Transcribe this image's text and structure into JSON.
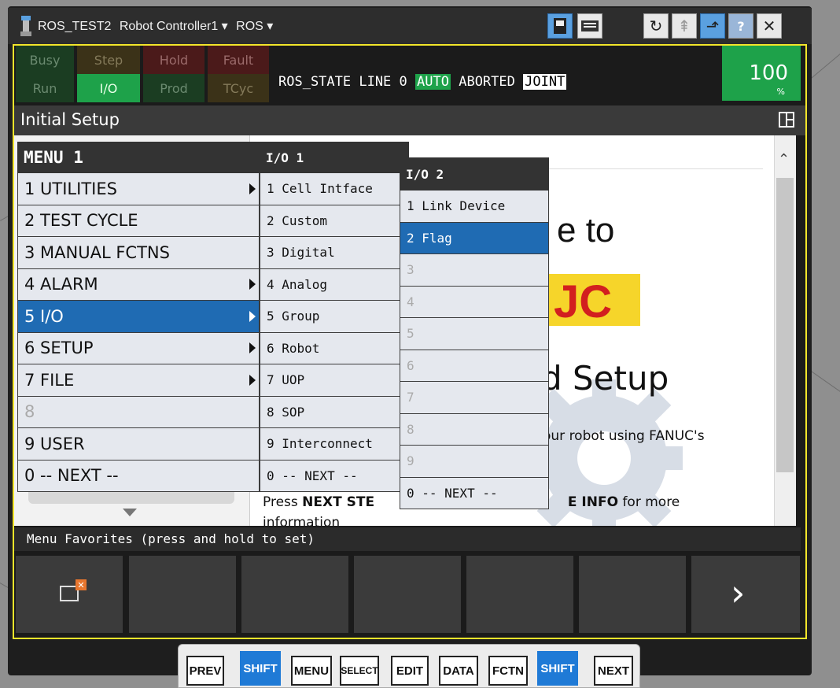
{
  "topbar": {
    "program": "ROS_TEST2",
    "controller": "Robot Controller1 ▾",
    "ros_tab": "ROS ▾"
  },
  "status": {
    "busy": "Busy",
    "step": "Step",
    "hold": "Hold",
    "fault": "Fault",
    "run": "Run",
    "io": "I/O",
    "prod": "Prod",
    "tcyc": "TCyc",
    "line_prefix": "ROS_STATE LINE 0",
    "auto": "AUTO",
    "aborted": "ABORTED",
    "joint": "JOINT"
  },
  "override": {
    "value": "100",
    "unit": "%"
  },
  "page": {
    "title": "Initial Setup"
  },
  "welcome": {
    "line1": "e to",
    "fanuc": "JC",
    "line2": "d Setup",
    "line3": "our robot using FANUC's",
    "line4_pre": "Press ",
    "line4_bold1": "NEXT STE",
    "line4_bold2": "E INFO",
    "line4_post": " for more",
    "line5": "information"
  },
  "menu1": {
    "header": "MENU  1",
    "items": [
      "1 UTILITIES",
      "2 TEST CYCLE",
      "3 MANUAL FCTNS",
      "4 ALARM",
      "5 I/O",
      "6 SETUP",
      "7 FILE",
      "8",
      "9 USER",
      "0 -- NEXT --"
    ]
  },
  "menu2": {
    "header": "I/O  1",
    "items": [
      "1 Cell Intface",
      "2 Custom",
      "3 Digital",
      "4 Analog",
      "5 Group",
      "6 Robot",
      "7 UOP",
      "8 SOP",
      "9 Interconnect",
      "0 -- NEXT --"
    ]
  },
  "menu3": {
    "header": "I/O  2",
    "items": [
      "1 Link Device",
      "2 Flag",
      "3",
      "4",
      "5",
      "6",
      "7",
      "8",
      "9",
      "0 -- NEXT --"
    ]
  },
  "favorites": {
    "label": "Menu Favorites (press and hold to set)"
  },
  "hardkeys": {
    "prev": "PREV",
    "shift1": "SHIFT",
    "menu": "MENU",
    "select": "SELECT",
    "edit": "EDIT",
    "data": "DATA",
    "fctn": "FCTN",
    "shift2": "SHIFT",
    "next": "NEXT"
  },
  "colors": {
    "accent_green": "#1ea24a",
    "selection_blue": "#1f6bb3",
    "frame_yellow": "#f2e52a",
    "fanuc_yellow": "#f6d52a",
    "fanuc_red": "#d21f1f"
  }
}
